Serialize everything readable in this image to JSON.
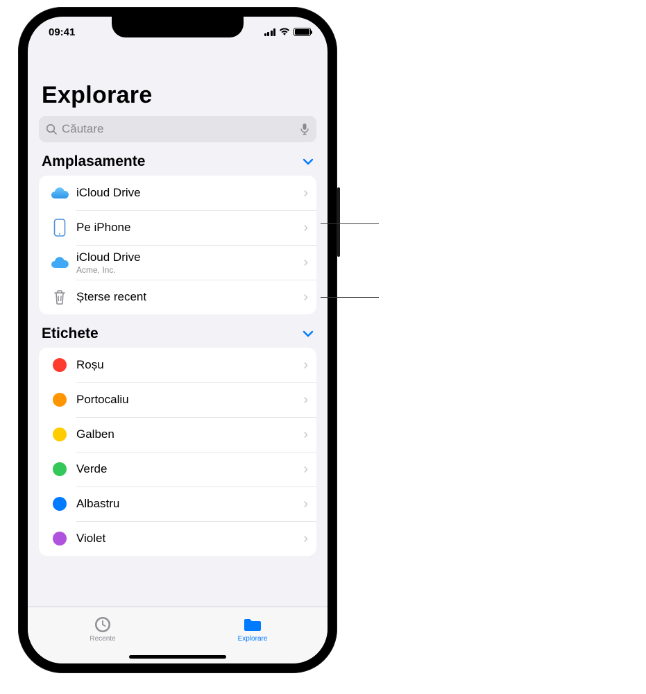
{
  "status": {
    "time": "09:41"
  },
  "title": "Explorare",
  "search": {
    "placeholder": "Căutare"
  },
  "sections": {
    "locations": {
      "title": "Amplasamente",
      "items": [
        {
          "label": "iCloud Drive",
          "icon": "cloud"
        },
        {
          "label": "Pe iPhone",
          "icon": "iphone"
        },
        {
          "label": "iCloud Drive",
          "sub": "Acme, Inc.",
          "icon": "cloud"
        },
        {
          "label": "Șterse recent",
          "icon": "trash"
        }
      ]
    },
    "tags": {
      "title": "Etichete",
      "items": [
        {
          "label": "Roșu",
          "color": "#ff3b30"
        },
        {
          "label": "Portocaliu",
          "color": "#ff9500"
        },
        {
          "label": "Galben",
          "color": "#ffcc00"
        },
        {
          "label": "Verde",
          "color": "#34c759"
        },
        {
          "label": "Albastru",
          "color": "#007aff"
        },
        {
          "label": "Violet",
          "color": "#af52de"
        }
      ]
    }
  },
  "tabs": {
    "recents": "Recente",
    "browse": "Explorare"
  }
}
